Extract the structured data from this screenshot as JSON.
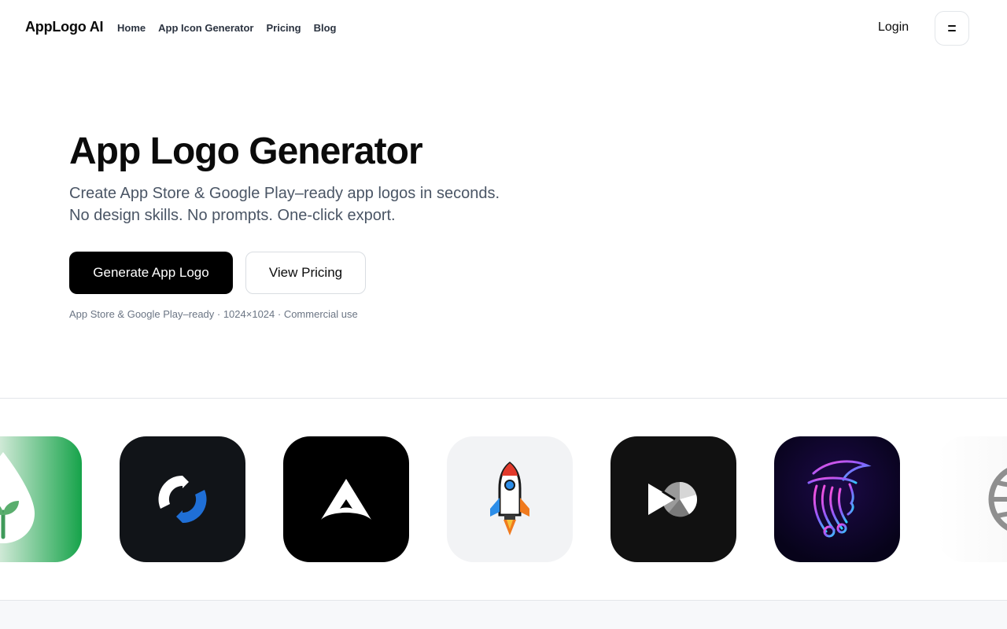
{
  "header": {
    "brand": "AppLogo AI",
    "nav": [
      "Home",
      "App Icon Generator",
      "Pricing",
      "Blog"
    ],
    "login": "Login",
    "menu_icon": "hamburger-icon"
  },
  "hero": {
    "title": "App Logo Generator",
    "subtitle_line1": "Create App Store & Google Play–ready app logos in seconds.",
    "subtitle_line2": "No design skills. No prompts. One-click export.",
    "primary_cta": "Generate App Logo",
    "secondary_cta": "View Pricing",
    "fine_print": "App Store & Google Play–ready · 1024×1024 · Commercial use"
  },
  "carousel": {
    "tiles": [
      {
        "icon": "drop-leaf-icon",
        "background": "#16a34a"
      },
      {
        "icon": "circular-arrows-icon",
        "background": "#111418"
      },
      {
        "icon": "arch-triangle-icon",
        "background": "#000000"
      },
      {
        "icon": "rocket-icon",
        "background": "#f2f3f5"
      },
      {
        "icon": "play-aperture-icon",
        "background": "#111111"
      },
      {
        "icon": "neon-witch-icon",
        "background": "#0a0520"
      },
      {
        "icon": "globe-icon",
        "background": "#fafafa"
      }
    ]
  },
  "colors": {
    "primary_button": "#000000",
    "subtitle_text": "#4a5565",
    "nav_text": "#2b3340"
  }
}
